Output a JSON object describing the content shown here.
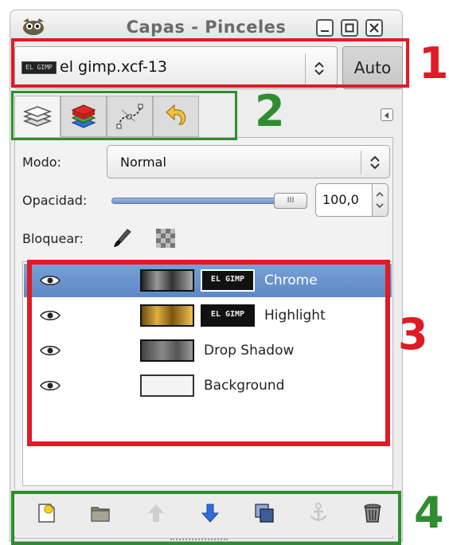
{
  "window": {
    "title": "Capas - Pinceles"
  },
  "image_selector": {
    "value": "el gimp.xcf-13",
    "thumb_text": "EL GIMP",
    "auto_label": "Auto"
  },
  "tabs": [
    {
      "name": "layers",
      "icon": "layers-icon",
      "active": true
    },
    {
      "name": "channels",
      "icon": "channels-icon",
      "active": false
    },
    {
      "name": "paths",
      "icon": "paths-icon",
      "active": false
    },
    {
      "name": "undo-history",
      "icon": "undo-icon",
      "active": false
    }
  ],
  "mode": {
    "label": "Modo:",
    "value": "Normal"
  },
  "opacity": {
    "label": "Opacidad:",
    "value": "100,0",
    "level": 1.0,
    "handle_grip": "III"
  },
  "lock": {
    "label": "Bloquear:"
  },
  "layers": [
    {
      "name": "Chrome",
      "visible": true,
      "selected": true,
      "has_mask": true,
      "mask_text": "EL GIMP"
    },
    {
      "name": "Highlight",
      "visible": true,
      "selected": false,
      "has_mask": true,
      "mask_text": "EL GIMP"
    },
    {
      "name": "Drop Shadow",
      "visible": true,
      "selected": false,
      "has_mask": false
    },
    {
      "name": "Background",
      "visible": true,
      "selected": false,
      "has_mask": false
    }
  ],
  "annotations": {
    "one": "1",
    "two": "2",
    "three": "3",
    "four": "4"
  },
  "colors": {
    "selection": "#5d88c6",
    "annotation_red": "#e01b24",
    "annotation_green": "#2f8d2f"
  }
}
